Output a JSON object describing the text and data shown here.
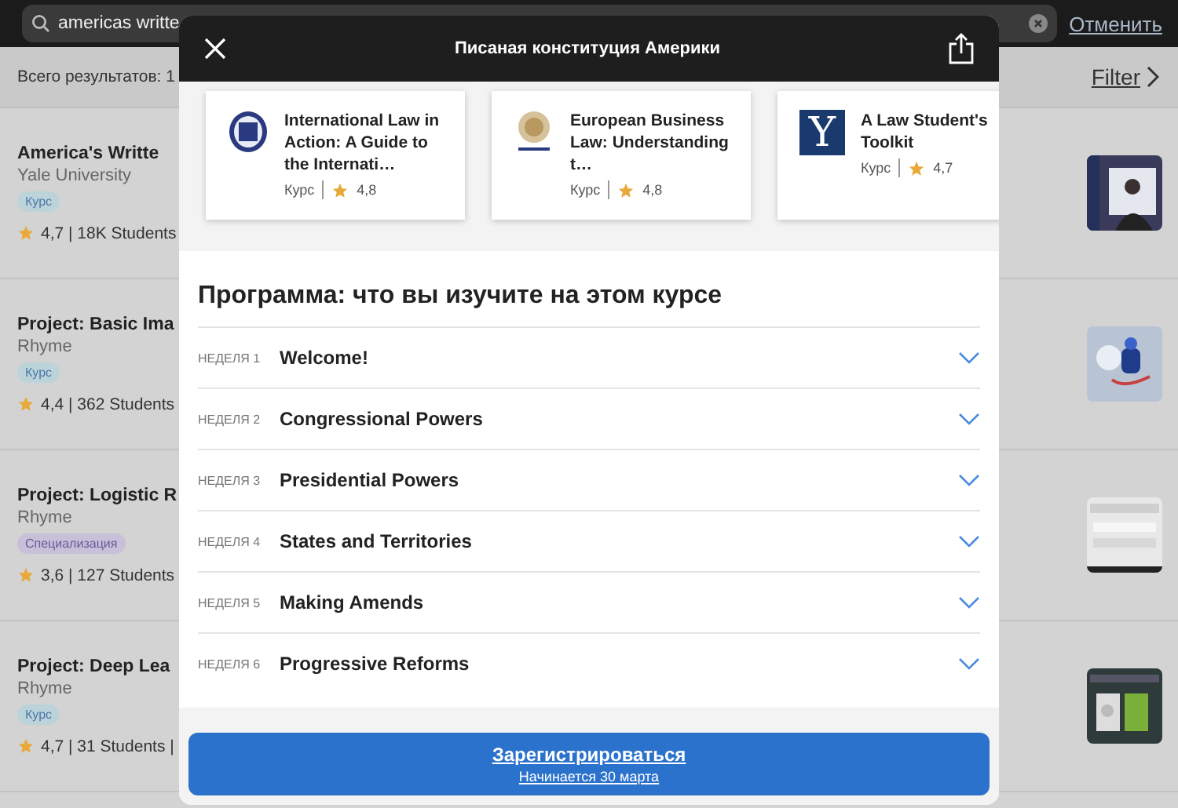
{
  "search": {
    "value": "americas writte",
    "cancel": "Отменить"
  },
  "results": {
    "count": "Всего результатов: 1",
    "filter": "Filter"
  },
  "courses": [
    {
      "title": "America's Writte",
      "provider": "Yale University",
      "tag": {
        "label": "Курс",
        "kind": "course"
      },
      "meta": "4,7 | 18K Students"
    },
    {
      "title": "Project: Basic Ima",
      "provider": "Rhyme",
      "tag": {
        "label": "Курс",
        "kind": "course"
      },
      "meta": "4,4 | 362 Students"
    },
    {
      "title": "Project: Logistic R",
      "provider": "Rhyme",
      "tag": {
        "label": "Специализация",
        "kind": "specialization"
      },
      "meta": "3,6 | 127 Students"
    },
    {
      "title": "Project: Deep Lea",
      "provider": "Rhyme",
      "tag": {
        "label": "Курс",
        "kind": "course"
      },
      "meta": "4,7 | 31 Students |"
    }
  ],
  "modal": {
    "title": "Писаная конституция Америки",
    "related": [
      {
        "title": "International Law in Action: A Guide to the Internati…",
        "type": "Курс",
        "rating": "4,8",
        "logo": {
          "kind": "seal"
        }
      },
      {
        "title": "European Business Law: Understanding t…",
        "type": "Курс",
        "rating": "4,8",
        "logo": {
          "kind": "lund"
        }
      },
      {
        "title": "A Law Student's Toolkit",
        "type": "Курс",
        "rating": "4,7",
        "logo": {
          "kind": "letter",
          "text": "Y"
        }
      }
    ],
    "syllabus_heading": "Программа: что вы изучите на этом курсе",
    "weeks": [
      {
        "label": "НЕДЕЛЯ 1",
        "title": "Welcome!",
        "expanded": false
      },
      {
        "label": "НЕДЕЛЯ 2",
        "title": "Congressional Powers",
        "expanded": false
      },
      {
        "label": "НЕДЕЛЯ 3",
        "title": "Presidential Powers",
        "expanded": false
      },
      {
        "label": "НЕДЕЛЯ 4",
        "title": "States and Territories",
        "expanded": false
      },
      {
        "label": "НЕДЕЛЯ 5",
        "title": "Making Amends",
        "expanded": false
      },
      {
        "label": "НЕДЕЛЯ 6",
        "title": "Progressive Reforms",
        "expanded": false
      }
    ],
    "enroll": {
      "label": "Зарегистрироваться",
      "sub": "Начинается 30 марта"
    }
  }
}
